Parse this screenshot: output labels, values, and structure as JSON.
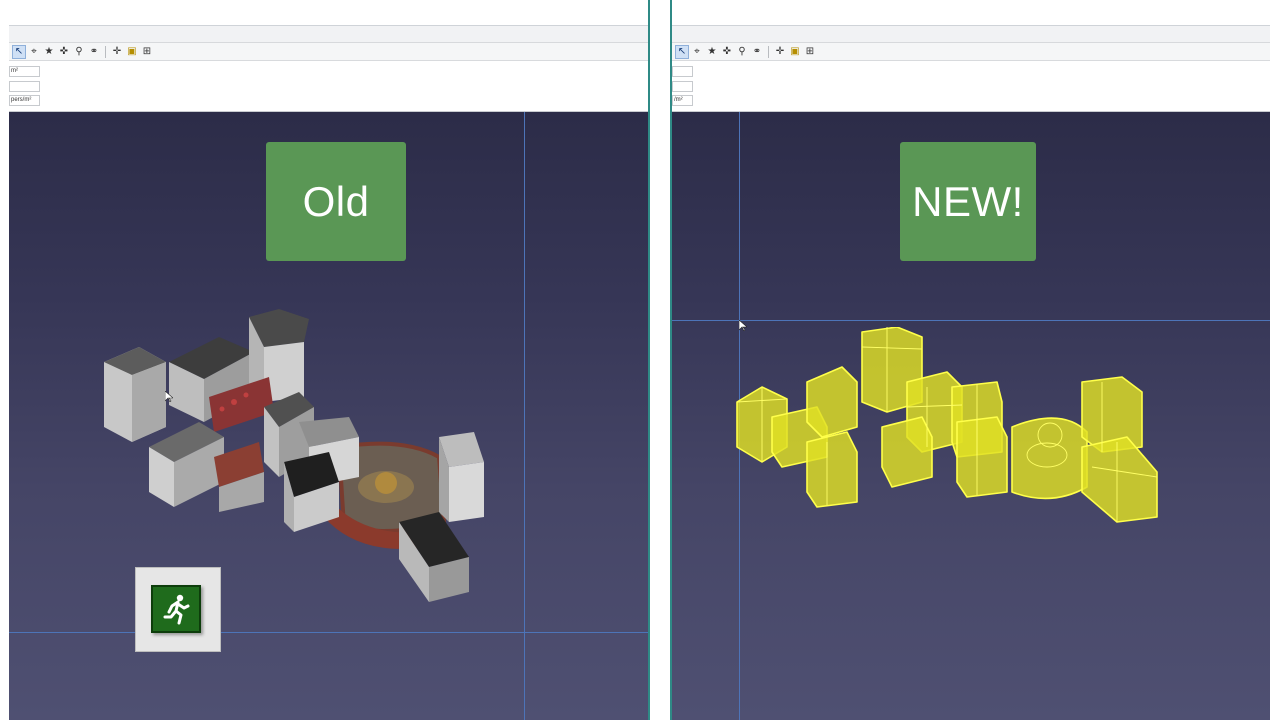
{
  "left_pane": {
    "toolbar_icons": [
      "select-arrow-icon",
      "target-icon",
      "walker-icon",
      "move-icon",
      "zoom-icon",
      "zoom-region-icon",
      "pan-icon",
      "highlight-icon",
      "grid-icon"
    ],
    "fields": [
      "m²",
      "",
      "pers/m²"
    ],
    "label": "Old"
  },
  "right_pane": {
    "toolbar_icons": [
      "select-arrow-icon",
      "target-icon",
      "walker-icon",
      "move-icon",
      "zoom-icon",
      "zoom-region-icon",
      "pan-icon",
      "highlight-icon",
      "grid-icon"
    ],
    "fields": [
      "",
      "",
      "/m²"
    ],
    "label": "NEW!"
  },
  "colors": {
    "label_badge": "#5a9755",
    "viewport_top": "#2c2c48",
    "viewport_bottom": "#4f5072",
    "gridline": "#4d74b8",
    "divider": "#2f8a86",
    "highlight_yellow": "#e6e61e",
    "exit_sign": "#1f6b1c"
  }
}
